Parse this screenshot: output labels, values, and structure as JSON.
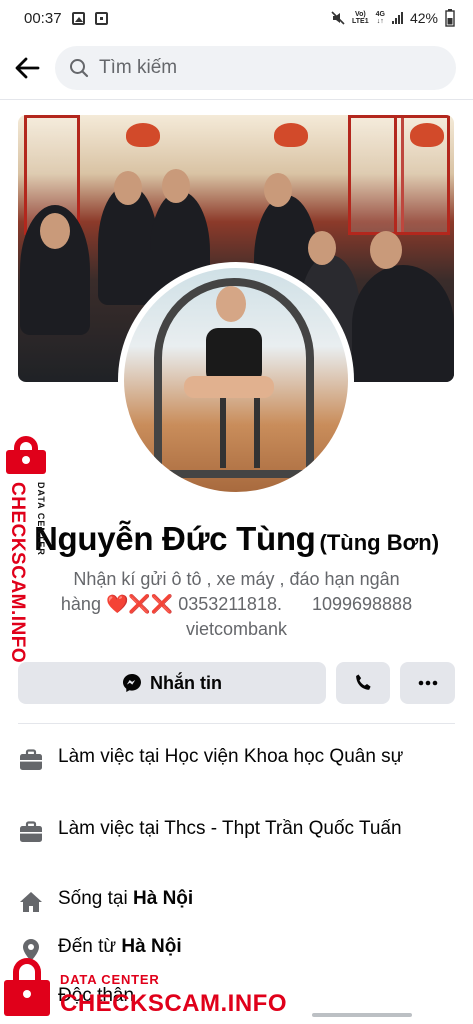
{
  "status_bar": {
    "time": "00:37",
    "network_top": "Vo)",
    "network_bottom": "LTE1",
    "net_type": "4G",
    "battery": "42%"
  },
  "header": {
    "back_icon": "arrow-left-icon",
    "search_placeholder": "Tìm kiếm"
  },
  "profile": {
    "name": "Nguyễn Đức Tùng",
    "alternate_name": "(Tùng Bơn)",
    "bio_line1": "Nhận kí gửi ô tô , xe máy , đáo hạn ngân",
    "bio_line2": "hàng ❤️❌❌ 0353211818.      1099698888",
    "bio_line3": "vietcombank"
  },
  "actions": {
    "message_label": "Nhắn tin",
    "message_icon": "messenger-icon",
    "call_icon": "phone-icon",
    "more_icon": "more-icon"
  },
  "details": [
    {
      "icon": "briefcase-icon",
      "text": "Làm việc tại Học viện Khoa học Quân sự"
    },
    {
      "icon": "briefcase-icon",
      "text": "Làm việc tại Thcs - Thpt Trần Quốc Tuấn"
    },
    {
      "icon": "home-icon",
      "prefix": "Sống tại ",
      "bold": "Hà Nội"
    },
    {
      "icon": "location-pin-icon",
      "prefix": "Đến từ ",
      "bold": "Hà Nội"
    },
    {
      "icon": "heart-icon",
      "text": "Độc thân"
    }
  ],
  "watermark": {
    "label_small": "DATA CENTER",
    "label_big": "CHECKSCAM.INFO",
    "color": "#e0001a"
  },
  "colors": {
    "background": "#ffffff",
    "button_bg": "#e4e6eb",
    "search_bg": "#f0f2f5",
    "secondary_text": "#65676b"
  }
}
